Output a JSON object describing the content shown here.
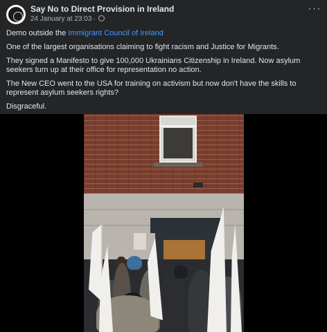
{
  "post": {
    "author": "Say No to Direct Provision in Ireland",
    "date": "24 January at 23:03",
    "date_separator": "·",
    "more_label": "···",
    "paragraphs": {
      "p1_prefix": "Demo outside the ",
      "p1_link": "Immigrant Council of Ireland",
      "p2": "One of the largest organisations claiming to fight racism and Justice for Migrants.",
      "p3": "They signed a Manifesto to give 100,000 Ukrainians Citizenship in Ireland. Now asylum seekers turn up at their office for representation no action.",
      "p4": "The New CEO went to the USA for training on activism but now don't have the skills to represent asylum seekers rights?",
      "p5": "Disgraceful."
    }
  },
  "icons": {
    "avatar": "page-avatar",
    "privacy": "globe-icon",
    "more": "more-options-icon"
  },
  "colors": {
    "background": "#242526",
    "text": "#e4e6eb",
    "secondary": "#b0b3b8",
    "link": "#4599ff"
  }
}
